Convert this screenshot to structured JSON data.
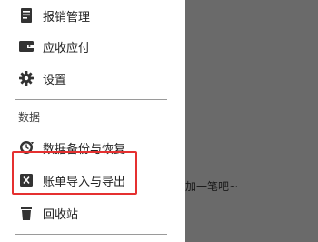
{
  "drawer": {
    "items": [
      {
        "label": "报销管理",
        "icon": "reimbursement-icon"
      },
      {
        "label": "应收应付",
        "icon": "wallet-icon"
      },
      {
        "label": "设置",
        "icon": "gear-icon"
      }
    ],
    "section_header": "数据",
    "data_items": [
      {
        "label": "数据备份与恢复",
        "icon": "backup-icon"
      },
      {
        "label": "账单导入与导出",
        "icon": "excel-icon"
      },
      {
        "label": "回收站",
        "icon": "trash-icon"
      }
    ]
  },
  "overlay": {
    "hint_text": "加一笔吧~"
  },
  "colors": {
    "overlay": "#6a6a6a",
    "highlight": "#e53030",
    "icon": "#333333"
  }
}
